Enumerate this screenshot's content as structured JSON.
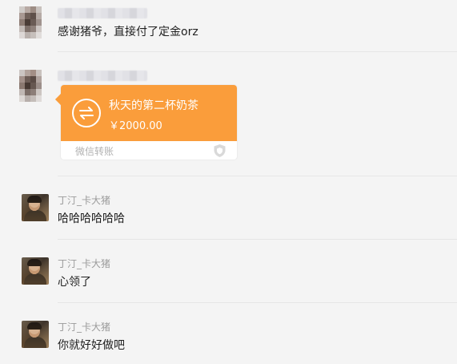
{
  "messages": [
    {
      "sender": "",
      "text": "感谢猪爷，直接付了定金orz"
    },
    {
      "sender": "",
      "transfer": {
        "title": "秋天的第二杯奶茶",
        "amount": "￥2000.00",
        "label": "微信转账"
      }
    },
    {
      "sender": "丁汀_卡大猪",
      "text": "哈哈哈哈哈哈"
    },
    {
      "sender": "丁汀_卡大猪",
      "text": "心领了"
    },
    {
      "sender": "丁汀_卡大猪",
      "text": "你就好好做吧"
    }
  ],
  "icons": {
    "mosaic_avatar": "pixelated-avatar-icon",
    "transfer": "transfer-arrows-icon",
    "shield": "shield-icon",
    "photo_avatar": "user-photo-avatar"
  },
  "colors": {
    "background": "#f4f4f4",
    "transfer_orange": "#fa9d3b",
    "text": "#1f1f1f",
    "sender": "#9b9b9b"
  }
}
